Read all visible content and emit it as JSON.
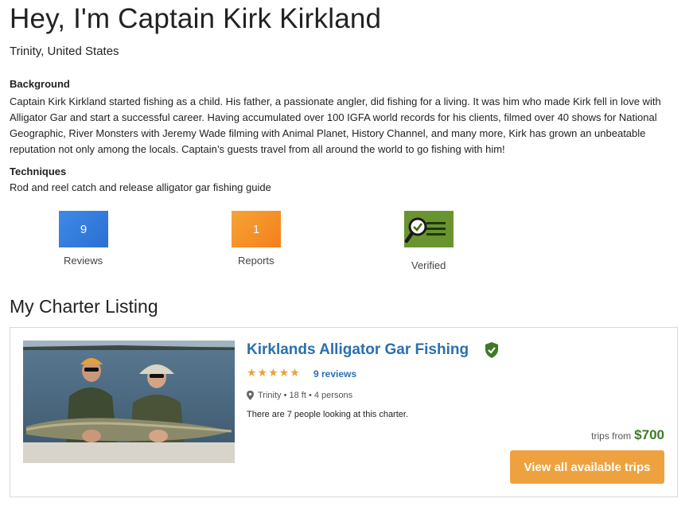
{
  "header": {
    "title": "Hey, I'm Captain Kirk Kirkland",
    "location": "Trinity, United States"
  },
  "background": {
    "heading": "Background",
    "text": "Captain Kirk Kirkland started fishing as a child. His father, a passionate angler, did fishing for a living. It was him who made Kirk fell in love with Alligator Gar and start a successful career. Having accumulated over 100 IGFA world records for his clients, filmed over 40 shows for National Geographic, River Monsters with Jeremy Wade filming with Animal Planet, History Channel, and many more, Kirk has grown an unbeatable reputation not only among the locals. Captain’s guests travel from all around the world to go fishing with him!"
  },
  "techniques": {
    "heading": "Techniques",
    "text": "Rod and reel catch and release alligator gar fishing guide"
  },
  "stats": {
    "reviews": {
      "count": "9",
      "label": "Reviews",
      "color": "#3a84e0"
    },
    "reports": {
      "count": "1",
      "label": "Reports",
      "color": "#f5901f"
    },
    "verified": {
      "label": "Verified",
      "icon": "verified-magnifier-icon",
      "color": "#6a942f"
    }
  },
  "listing": {
    "section_title": "My Charter Listing",
    "name": "Kirklands Alligator Gar Fishing",
    "verified_icon": "shield-check-icon",
    "stars": "★★★★★",
    "rating": 5,
    "reviews_label": "9 reviews",
    "meta": "Trinity • 18 ft • 4 persons",
    "location_icon": "map-pin-icon",
    "looking_text": "There are 7 people looking at this charter.",
    "price_prefix": "trips from",
    "price": "$700",
    "cta_label": "View all available trips",
    "colors": {
      "link": "#2a6fb0",
      "star": "#e8a33a",
      "price": "#3d7a26",
      "cta": "#eea23f"
    }
  }
}
